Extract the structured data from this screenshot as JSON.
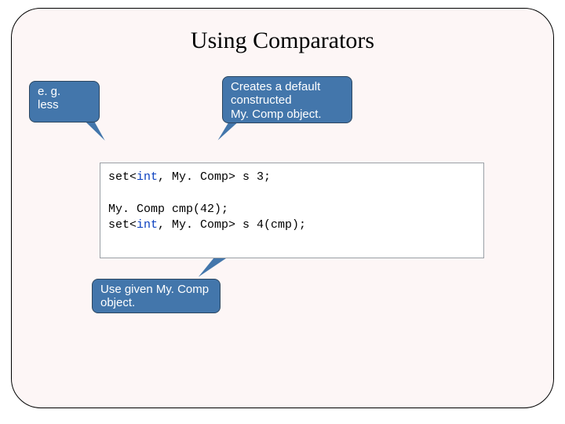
{
  "title": "Using Comparators",
  "callouts": {
    "eg": "e. g.\nless",
    "default": "Creates a default\nconstructed\nMy. Comp object.",
    "given": "Use given My. Comp\nobject."
  },
  "code": {
    "line1_pre": "set<",
    "line1_kw": "int",
    "line1_post": ", My. Comp> s 3;",
    "blank": " ",
    "line3": "My. Comp cmp(42);",
    "line4_pre": "set<",
    "line4_kw": "int",
    "line4_post": ", My. Comp> s 4(cmp);"
  }
}
